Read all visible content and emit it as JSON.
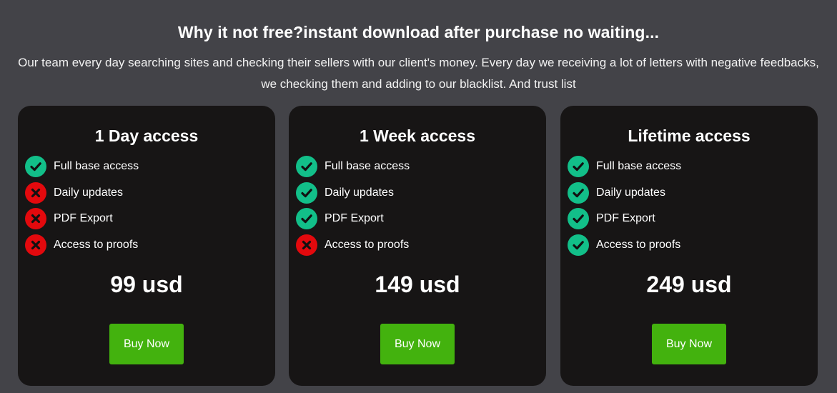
{
  "heading": "Why it not free?instant download after purchase no waiting...",
  "intro": "Our team every day searching sites and checking their sellers with our client's money. Every day we receiving a lot of letters with negative feedbacks, we checking them and adding to our blacklist. And trust list",
  "colors": {
    "background": "#434348",
    "card_background": "#171515",
    "included": "#12bf89",
    "excluded": "#e3090d",
    "button": "#43b20e"
  },
  "plans": [
    {
      "title": "1 Day access",
      "features": [
        {
          "label": "Full base access",
          "included": true,
          "icon": "check-circle-icon"
        },
        {
          "label": "Daily updates",
          "included": false,
          "icon": "x-circle-icon"
        },
        {
          "label": "PDF Export",
          "included": false,
          "icon": "x-circle-icon"
        },
        {
          "label": "Access to proofs",
          "included": false,
          "icon": "x-circle-icon"
        }
      ],
      "price": "99 usd",
      "button_label": "Buy Now"
    },
    {
      "title": "1 Week access",
      "features": [
        {
          "label": "Full base access",
          "included": true,
          "icon": "check-circle-icon"
        },
        {
          "label": "Daily updates",
          "included": true,
          "icon": "check-circle-icon"
        },
        {
          "label": "PDF Export",
          "included": true,
          "icon": "check-circle-icon"
        },
        {
          "label": "Access to proofs",
          "included": false,
          "icon": "x-circle-icon"
        }
      ],
      "price": "149 usd",
      "button_label": "Buy Now"
    },
    {
      "title": "Lifetime access",
      "features": [
        {
          "label": "Full base access",
          "included": true,
          "icon": "check-circle-icon"
        },
        {
          "label": "Daily updates",
          "included": true,
          "icon": "check-circle-icon"
        },
        {
          "label": "PDF Export",
          "included": true,
          "icon": "check-circle-icon"
        },
        {
          "label": "Access to proofs",
          "included": true,
          "icon": "check-circle-icon"
        }
      ],
      "price": "249 usd",
      "button_label": "Buy Now"
    }
  ]
}
